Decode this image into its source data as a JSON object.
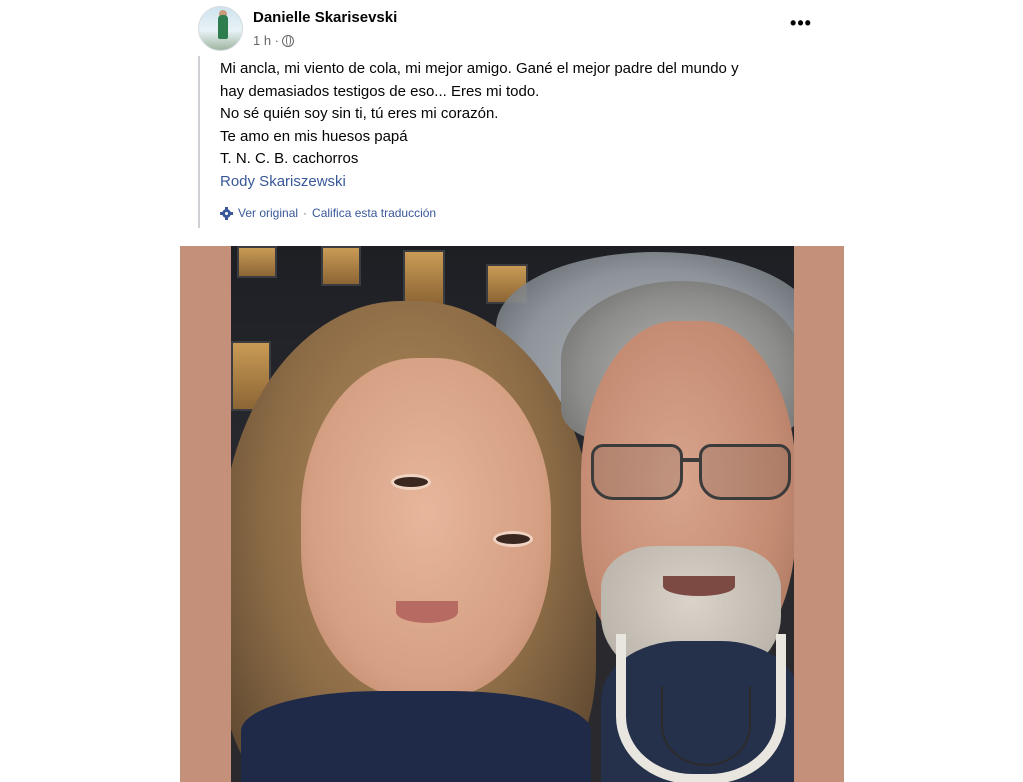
{
  "post": {
    "author": "Danielle Skarisevski",
    "time": "1 h ·",
    "more_label": "•••",
    "body_lines": [
      "Mi ancla, mi viento de cola, mi mejor amigo. Gané el mejor padre del mundo y",
      "hay demasiados testigos de eso... Eres mi todo.",
      "No sé quién soy sin ti, tú eres mi corazón.",
      "Te amo en mis huesos papá",
      "T. N. C. B. cachorros"
    ],
    "mention": "Rody Skariszewski",
    "translation": {
      "view_original": "Ver original",
      "separator": "·",
      "rate_translation": "Califica esta traducción"
    }
  },
  "icons": {
    "privacy": "globe-icon",
    "options": "more-icon",
    "translation": "gear-icon"
  },
  "colors": {
    "link": "#385898",
    "meta": "#65676b",
    "photo_border": "#c4907a"
  }
}
